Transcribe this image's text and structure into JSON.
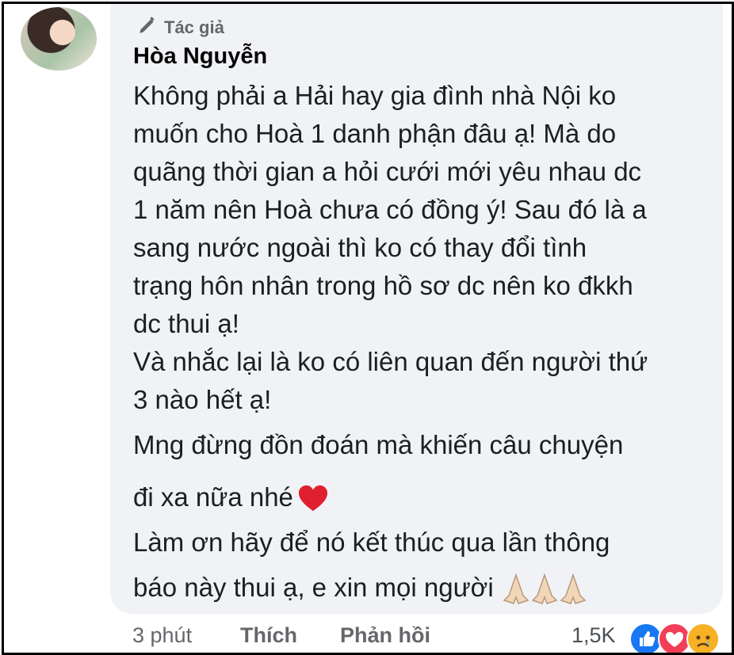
{
  "comment": {
    "author_badge": "Tác giả",
    "author_name": "Hòa Nguyễn",
    "text_lines": [
      "Không phải a Hải hay gia đình nhà Nội ko",
      "muốn cho Hoà 1 danh phận đâu ạ! Mà do",
      "quãng thời gian a hỏi cưới mới yêu nhau dc",
      "1 năm nên Hoà chưa có đồng ý! Sau đó là a",
      "sang nước ngoài thì ko có thay đổi tình",
      "trạng hôn nhân trong hồ sơ dc nên ko đkkh",
      "dc thui ạ!",
      "Và nhắc lại là ko có liên quan đến người thứ",
      "3 nào hết ạ!",
      "Mng đừng đồn đoán mà khiến câu chuyện",
      "đi xa nữa nhé",
      "Làm ơn hãy để nó kết thúc qua lần thông",
      "báo này thui ạ, e xin mọi người"
    ]
  },
  "footer": {
    "time": "3 phút",
    "like_label": "Thích",
    "reply_label": "Phản hồi",
    "reaction_count": "1,5K"
  },
  "icons": {
    "badge": "pen-icon",
    "heart_emoji": "red-heart-emoji",
    "pray_emoji": "folded-hands-emoji",
    "reactions": [
      "like-reaction-icon",
      "love-reaction-icon",
      "sad-reaction-icon"
    ]
  },
  "colors": {
    "bubble": "#f0f2f5",
    "like_blue": "#1877f2",
    "love_red": "#f33e58",
    "sad_yellow": "#f7b125"
  }
}
